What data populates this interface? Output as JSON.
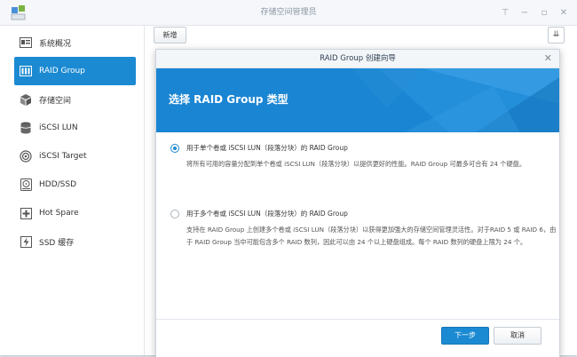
{
  "window": {
    "title": "存储空间管理员"
  },
  "sidebar": {
    "items": [
      {
        "label": "系统概况",
        "icon": "overview-icon"
      },
      {
        "label": "RAID Group",
        "icon": "raid-icon",
        "active": true
      },
      {
        "label": "存储空间",
        "icon": "storage-icon"
      },
      {
        "label": "iSCSI LUN",
        "icon": "lun-icon"
      },
      {
        "label": "iSCSI Target",
        "icon": "target-icon"
      },
      {
        "label": "HDD/SSD",
        "icon": "disk-icon"
      },
      {
        "label": "Hot Spare",
        "icon": "hot-spare-icon"
      },
      {
        "label": "SSD 缓存",
        "icon": "ssd-cache-icon"
      }
    ]
  },
  "toolbar": {
    "new_label": "新增"
  },
  "dialog": {
    "title": "RAID Group 创建向导",
    "banner_title": "选择 RAID Group 类型",
    "options": [
      {
        "label": "用于单个卷或 iSCSI LUN（段落分块）的 RAID Group",
        "desc": "将所有可用的容量分配到单个卷或 iSCSI LUN（段落分块）以提供更好的性能。RAID Group 可最多可合有 24 个硬盘。",
        "selected": true
      },
      {
        "label": "用于多个卷或 iSCSI LUN（段落分块）的 RAID Group",
        "desc": "支持在 RAID Group 上创建多个卷或 iSCSI LUN（段落分块）以获得更加强大的存储空间管理灵活性。对于RAID 5 或 RAID 6，由于 RAID Group 当中可能包含多个 RAID 数列，因此可以由 24 个以上硬盘组成。每个 RAID 数列的硬盘上限为 24 个。",
        "selected": false
      }
    ],
    "next_label": "下一步",
    "cancel_label": "取消"
  },
  "colors": {
    "accent": "#1b8ad2",
    "banner": "#1a85d3"
  }
}
